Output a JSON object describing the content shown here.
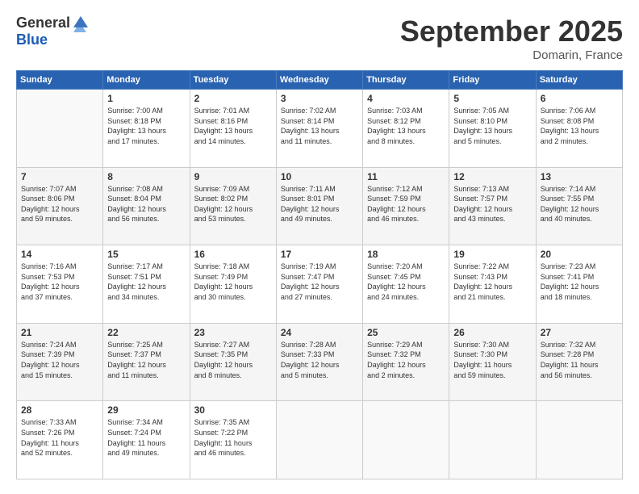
{
  "logo": {
    "general": "General",
    "blue": "Blue"
  },
  "title": "September 2025",
  "location": "Domarin, France",
  "weekdays": [
    "Sunday",
    "Monday",
    "Tuesday",
    "Wednesday",
    "Thursday",
    "Friday",
    "Saturday"
  ],
  "weeks": [
    [
      {
        "day": "",
        "info": ""
      },
      {
        "day": "1",
        "info": "Sunrise: 7:00 AM\nSunset: 8:18 PM\nDaylight: 13 hours\nand 17 minutes."
      },
      {
        "day": "2",
        "info": "Sunrise: 7:01 AM\nSunset: 8:16 PM\nDaylight: 13 hours\nand 14 minutes."
      },
      {
        "day": "3",
        "info": "Sunrise: 7:02 AM\nSunset: 8:14 PM\nDaylight: 13 hours\nand 11 minutes."
      },
      {
        "day": "4",
        "info": "Sunrise: 7:03 AM\nSunset: 8:12 PM\nDaylight: 13 hours\nand 8 minutes."
      },
      {
        "day": "5",
        "info": "Sunrise: 7:05 AM\nSunset: 8:10 PM\nDaylight: 13 hours\nand 5 minutes."
      },
      {
        "day": "6",
        "info": "Sunrise: 7:06 AM\nSunset: 8:08 PM\nDaylight: 13 hours\nand 2 minutes."
      }
    ],
    [
      {
        "day": "7",
        "info": "Sunrise: 7:07 AM\nSunset: 8:06 PM\nDaylight: 12 hours\nand 59 minutes."
      },
      {
        "day": "8",
        "info": "Sunrise: 7:08 AM\nSunset: 8:04 PM\nDaylight: 12 hours\nand 56 minutes."
      },
      {
        "day": "9",
        "info": "Sunrise: 7:09 AM\nSunset: 8:02 PM\nDaylight: 12 hours\nand 53 minutes."
      },
      {
        "day": "10",
        "info": "Sunrise: 7:11 AM\nSunset: 8:01 PM\nDaylight: 12 hours\nand 49 minutes."
      },
      {
        "day": "11",
        "info": "Sunrise: 7:12 AM\nSunset: 7:59 PM\nDaylight: 12 hours\nand 46 minutes."
      },
      {
        "day": "12",
        "info": "Sunrise: 7:13 AM\nSunset: 7:57 PM\nDaylight: 12 hours\nand 43 minutes."
      },
      {
        "day": "13",
        "info": "Sunrise: 7:14 AM\nSunset: 7:55 PM\nDaylight: 12 hours\nand 40 minutes."
      }
    ],
    [
      {
        "day": "14",
        "info": "Sunrise: 7:16 AM\nSunset: 7:53 PM\nDaylight: 12 hours\nand 37 minutes."
      },
      {
        "day": "15",
        "info": "Sunrise: 7:17 AM\nSunset: 7:51 PM\nDaylight: 12 hours\nand 34 minutes."
      },
      {
        "day": "16",
        "info": "Sunrise: 7:18 AM\nSunset: 7:49 PM\nDaylight: 12 hours\nand 30 minutes."
      },
      {
        "day": "17",
        "info": "Sunrise: 7:19 AM\nSunset: 7:47 PM\nDaylight: 12 hours\nand 27 minutes."
      },
      {
        "day": "18",
        "info": "Sunrise: 7:20 AM\nSunset: 7:45 PM\nDaylight: 12 hours\nand 24 minutes."
      },
      {
        "day": "19",
        "info": "Sunrise: 7:22 AM\nSunset: 7:43 PM\nDaylight: 12 hours\nand 21 minutes."
      },
      {
        "day": "20",
        "info": "Sunrise: 7:23 AM\nSunset: 7:41 PM\nDaylight: 12 hours\nand 18 minutes."
      }
    ],
    [
      {
        "day": "21",
        "info": "Sunrise: 7:24 AM\nSunset: 7:39 PM\nDaylight: 12 hours\nand 15 minutes."
      },
      {
        "day": "22",
        "info": "Sunrise: 7:25 AM\nSunset: 7:37 PM\nDaylight: 12 hours\nand 11 minutes."
      },
      {
        "day": "23",
        "info": "Sunrise: 7:27 AM\nSunset: 7:35 PM\nDaylight: 12 hours\nand 8 minutes."
      },
      {
        "day": "24",
        "info": "Sunrise: 7:28 AM\nSunset: 7:33 PM\nDaylight: 12 hours\nand 5 minutes."
      },
      {
        "day": "25",
        "info": "Sunrise: 7:29 AM\nSunset: 7:32 PM\nDaylight: 12 hours\nand 2 minutes."
      },
      {
        "day": "26",
        "info": "Sunrise: 7:30 AM\nSunset: 7:30 PM\nDaylight: 11 hours\nand 59 minutes."
      },
      {
        "day": "27",
        "info": "Sunrise: 7:32 AM\nSunset: 7:28 PM\nDaylight: 11 hours\nand 56 minutes."
      }
    ],
    [
      {
        "day": "28",
        "info": "Sunrise: 7:33 AM\nSunset: 7:26 PM\nDaylight: 11 hours\nand 52 minutes."
      },
      {
        "day": "29",
        "info": "Sunrise: 7:34 AM\nSunset: 7:24 PM\nDaylight: 11 hours\nand 49 minutes."
      },
      {
        "day": "30",
        "info": "Sunrise: 7:35 AM\nSunset: 7:22 PM\nDaylight: 11 hours\nand 46 minutes."
      },
      {
        "day": "",
        "info": ""
      },
      {
        "day": "",
        "info": ""
      },
      {
        "day": "",
        "info": ""
      },
      {
        "day": "",
        "info": ""
      }
    ]
  ]
}
